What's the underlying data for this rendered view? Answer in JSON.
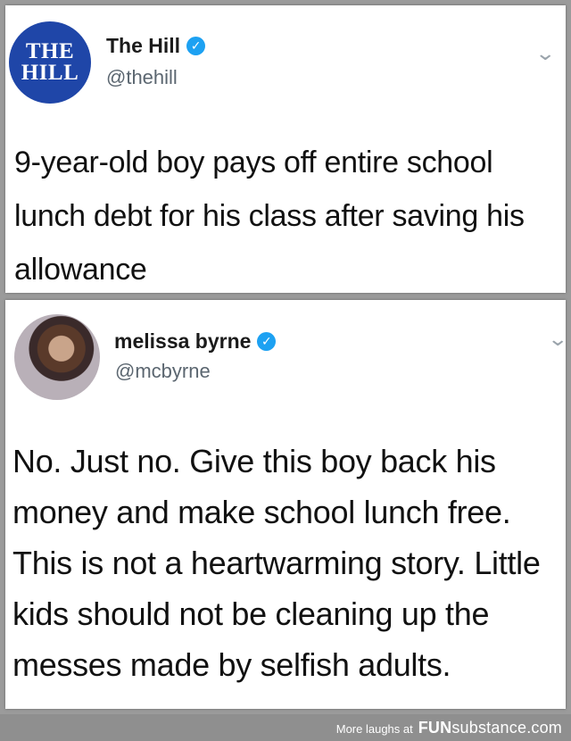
{
  "tweets": [
    {
      "avatar_text": [
        "THE",
        "HILL"
      ],
      "display_name": "The Hill",
      "handle": "@thehill",
      "verified": true,
      "text": "9-year-old boy pays off entire school lunch debt for his class after saving his allowance"
    },
    {
      "display_name": "melissa byrne",
      "handle": "@mcbyrne",
      "verified": true,
      "text": "No. Just no. Give this boy back his money and make school lunch free. This is not a heartwarming story. Little kids should not be cleaning up the messes made by selfish adults."
    }
  ],
  "footer": {
    "prefix": "More laughs at",
    "brand_fun": "FUN",
    "brand_sub": "substance",
    "brand_tld": ".com"
  },
  "colors": {
    "verified": "#1da1f2",
    "hill_logo": "#1f46a8",
    "background": "#9b9b9b"
  },
  "icons": {
    "verified": "check-badge",
    "menu": "chevron-down"
  }
}
